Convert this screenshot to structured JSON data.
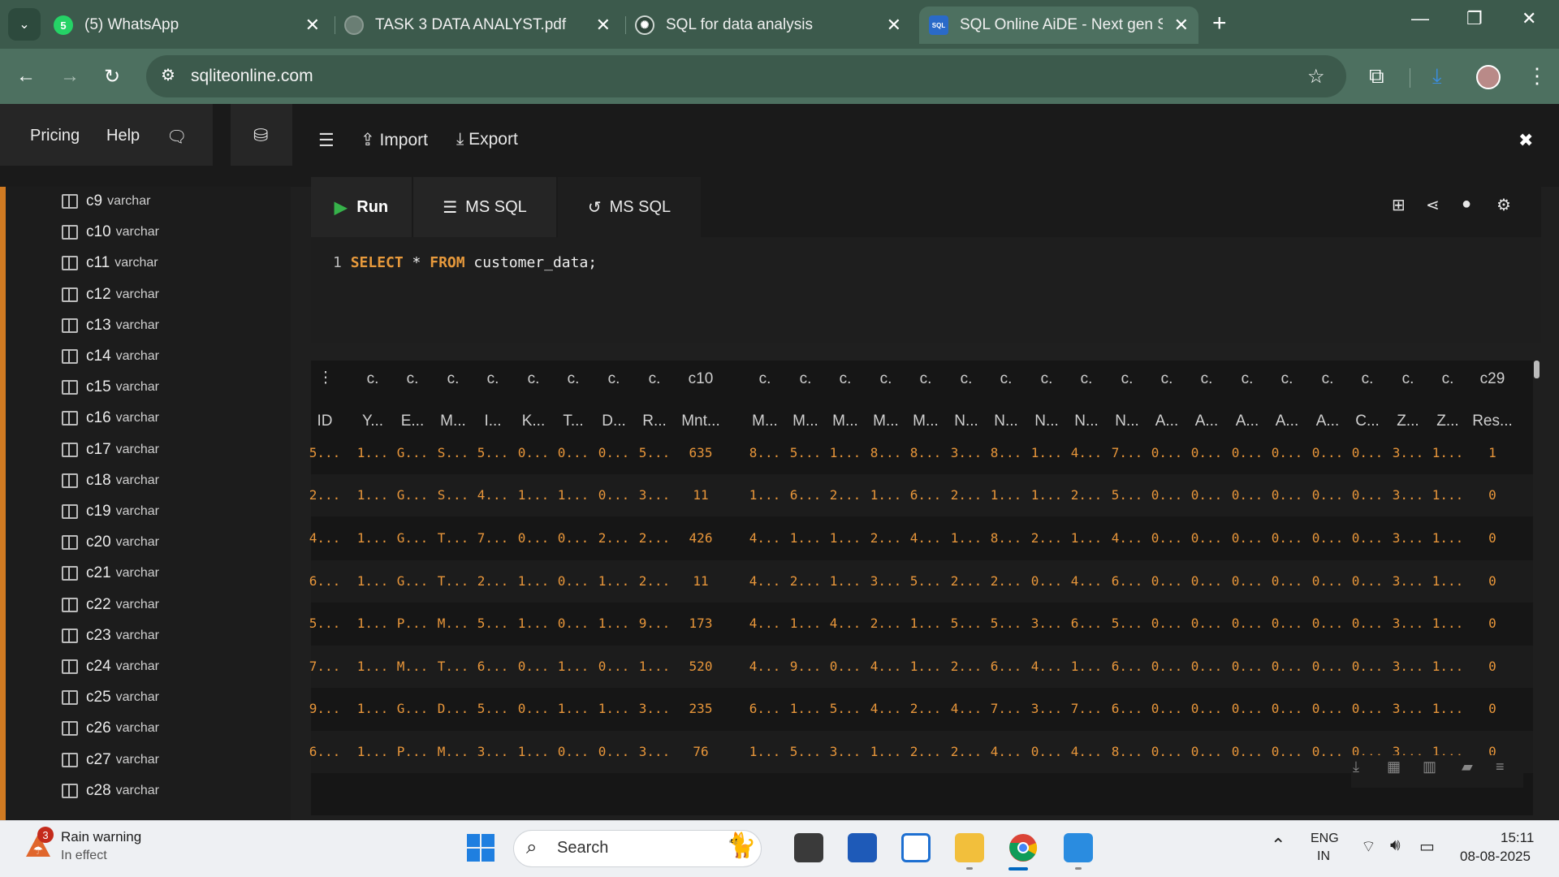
{
  "browser": {
    "tabs": [
      {
        "title": "(5) WhatsApp"
      },
      {
        "title": "TASK 3 DATA ANALYST.pdf"
      },
      {
        "title": "SQL for data analysis"
      },
      {
        "title": "SQL Online AiDE - Next gen SQ"
      }
    ],
    "url": "sqliteonline.com"
  },
  "header": {
    "pricing": "Pricing",
    "help": "Help",
    "import": "Import",
    "export": "Export"
  },
  "sidebar": {
    "columns": [
      {
        "name": "c9",
        "type": "varchar"
      },
      {
        "name": "c10",
        "type": "varchar"
      },
      {
        "name": "c11",
        "type": "varchar"
      },
      {
        "name": "c12",
        "type": "varchar"
      },
      {
        "name": "c13",
        "type": "varchar"
      },
      {
        "name": "c14",
        "type": "varchar"
      },
      {
        "name": "c15",
        "type": "varchar"
      },
      {
        "name": "c16",
        "type": "varchar"
      },
      {
        "name": "c17",
        "type": "varchar"
      },
      {
        "name": "c18",
        "type": "varchar"
      },
      {
        "name": "c19",
        "type": "varchar"
      },
      {
        "name": "c20",
        "type": "varchar"
      },
      {
        "name": "c21",
        "type": "varchar"
      },
      {
        "name": "c22",
        "type": "varchar"
      },
      {
        "name": "c23",
        "type": "varchar"
      },
      {
        "name": "c24",
        "type": "varchar"
      },
      {
        "name": "c25",
        "type": "varchar"
      },
      {
        "name": "c26",
        "type": "varchar"
      },
      {
        "name": "c27",
        "type": "varchar"
      },
      {
        "name": "c28",
        "type": "varchar"
      }
    ]
  },
  "editor": {
    "run": "Run",
    "tab1": "MS SQL",
    "tab2": "MS SQL",
    "line_number": "1",
    "kw_select": "SELECT",
    "star": " * ",
    "kw_from": "FROM",
    "rest": " customer_data;"
  },
  "grid": {
    "menu_glyph": "⋮",
    "header1": [
      "c.",
      "c.",
      "c.",
      "c.",
      "c.",
      "c.",
      "c.",
      "c.",
      "c10",
      "c.",
      "c.",
      "c.",
      "c.",
      "c.",
      "c.",
      "c.",
      "c.",
      "c.",
      "c.",
      "c.",
      "c.",
      "c.",
      "c.",
      "c.",
      "c.",
      "c.",
      "c.",
      "c29"
    ],
    "header2": [
      "ID",
      "Y...",
      "E...",
      "M...",
      "I...",
      "K...",
      "T...",
      "D...",
      "R...",
      "Mnt...",
      "M...",
      "M...",
      "M...",
      "M...",
      "M...",
      "N...",
      "N...",
      "N...",
      "N...",
      "N...",
      "A...",
      "A...",
      "A...",
      "A...",
      "A...",
      "C...",
      "Z...",
      "Z...",
      "Res..."
    ],
    "rows": [
      [
        "5...",
        "1...",
        "G...",
        "S...",
        "5...",
        "0...",
        "0...",
        "0...",
        "5...",
        "635",
        "8...",
        "5...",
        "1...",
        "8...",
        "8...",
        "3...",
        "8...",
        "1...",
        "4...",
        "7...",
        "0...",
        "0...",
        "0...",
        "0...",
        "0...",
        "0...",
        "3...",
        "1...",
        "1"
      ],
      [
        "2...",
        "1...",
        "G...",
        "S...",
        "4...",
        "1...",
        "1...",
        "0...",
        "3...",
        "11",
        "1...",
        "6...",
        "2...",
        "1...",
        "6...",
        "2...",
        "1...",
        "1...",
        "2...",
        "5...",
        "0...",
        "0...",
        "0...",
        "0...",
        "0...",
        "0...",
        "3...",
        "1...",
        "0"
      ],
      [
        "4...",
        "1...",
        "G...",
        "T...",
        "7...",
        "0...",
        "0...",
        "2...",
        "2...",
        "426",
        "4...",
        "1...",
        "1...",
        "2...",
        "4...",
        "1...",
        "8...",
        "2...",
        "1...",
        "4...",
        "0...",
        "0...",
        "0...",
        "0...",
        "0...",
        "0...",
        "3...",
        "1...",
        "0"
      ],
      [
        "6...",
        "1...",
        "G...",
        "T...",
        "2...",
        "1...",
        "0...",
        "1...",
        "2...",
        "11",
        "4...",
        "2...",
        "1...",
        "3...",
        "5...",
        "2...",
        "2...",
        "0...",
        "4...",
        "6...",
        "0...",
        "0...",
        "0...",
        "0...",
        "0...",
        "0...",
        "3...",
        "1...",
        "0"
      ],
      [
        "5...",
        "1...",
        "P...",
        "M...",
        "5...",
        "1...",
        "0...",
        "1...",
        "9...",
        "173",
        "4...",
        "1...",
        "4...",
        "2...",
        "1...",
        "5...",
        "5...",
        "3...",
        "6...",
        "5...",
        "0...",
        "0...",
        "0...",
        "0...",
        "0...",
        "0...",
        "3...",
        "1...",
        "0"
      ],
      [
        "7...",
        "1...",
        "M...",
        "T...",
        "6...",
        "0...",
        "1...",
        "0...",
        "1...",
        "520",
        "4...",
        "9...",
        "0...",
        "4...",
        "1...",
        "2...",
        "6...",
        "4...",
        "1...",
        "6...",
        "0...",
        "0...",
        "0...",
        "0...",
        "0...",
        "0...",
        "3...",
        "1...",
        "0"
      ],
      [
        "9...",
        "1...",
        "G...",
        "D...",
        "5...",
        "0...",
        "1...",
        "1...",
        "3...",
        "235",
        "6...",
        "1...",
        "5...",
        "4...",
        "2...",
        "4...",
        "7...",
        "3...",
        "7...",
        "6...",
        "0...",
        "0...",
        "0...",
        "0...",
        "0...",
        "0...",
        "3...",
        "1...",
        "0"
      ],
      [
        "6...",
        "1...",
        "P...",
        "M...",
        "3...",
        "1...",
        "0...",
        "0...",
        "3...",
        "76",
        "1...",
        "5...",
        "3...",
        "1...",
        "2...",
        "2...",
        "4...",
        "0...",
        "4...",
        "8...",
        "0...",
        "0...",
        "0...",
        "0...",
        "0...",
        "0...",
        "3...",
        "1...",
        "0"
      ]
    ]
  },
  "taskbar": {
    "weather_title": "Rain warning",
    "weather_sub": "In effect",
    "weather_badge": "3",
    "search": "Search",
    "lang1": "ENG",
    "lang2": "IN",
    "time": "15:11",
    "date": "08-08-2025"
  },
  "colors": {
    "accent": "#d07a22",
    "keyword": "#e89a3c",
    "run_green": "#36b24a",
    "chrome_green": "#4d7060"
  }
}
